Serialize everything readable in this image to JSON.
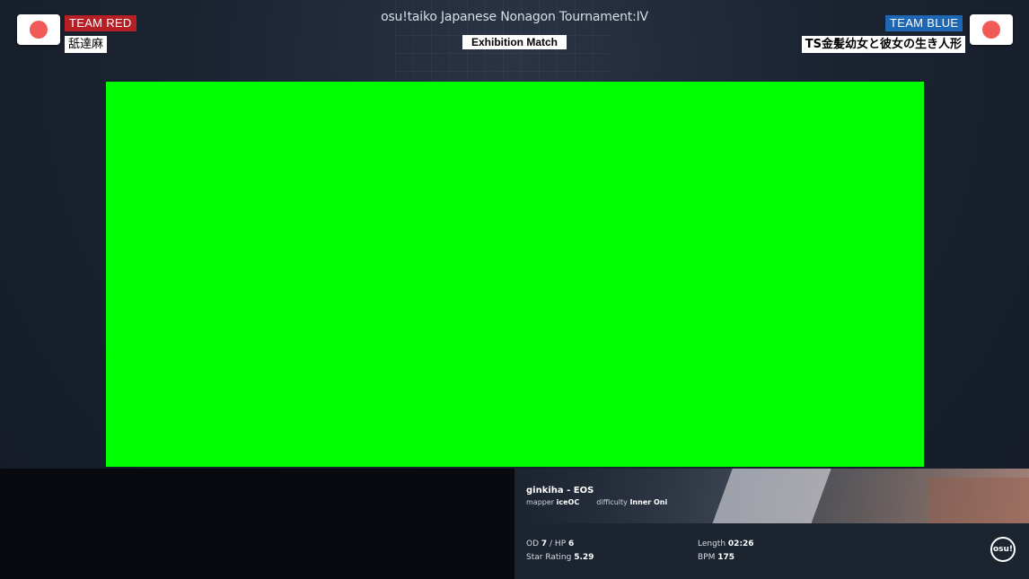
{
  "tournament": {
    "title": "osu!taiko Japanese Nonagon Tournament:IV",
    "round": "Exhibition Match"
  },
  "team_red": {
    "label": "TEAM RED",
    "player": "舐達麻",
    "flag": "japan-flag",
    "color": "#b61f24"
  },
  "team_blue": {
    "label": "TEAM BLUE",
    "player": "TS金髪幼女と彼女の生き人形",
    "flag": "japan-flag",
    "color": "#1e67b4"
  },
  "gameplay": {
    "color": "#00ff00"
  },
  "beatmap": {
    "title": "ginkiha - EOS",
    "mapper_label": "mapper",
    "mapper": "iceOC",
    "difficulty_label": "difficulty",
    "difficulty": "Inner Oni",
    "od_label": "OD",
    "od": "7",
    "hp_label": "/ HP",
    "hp": "6",
    "star_label": "Star Rating",
    "star": "5.29",
    "length_label": "Length",
    "length": "02:26",
    "bpm_label": "BPM",
    "bpm": "175",
    "logo_text": "osu!"
  }
}
